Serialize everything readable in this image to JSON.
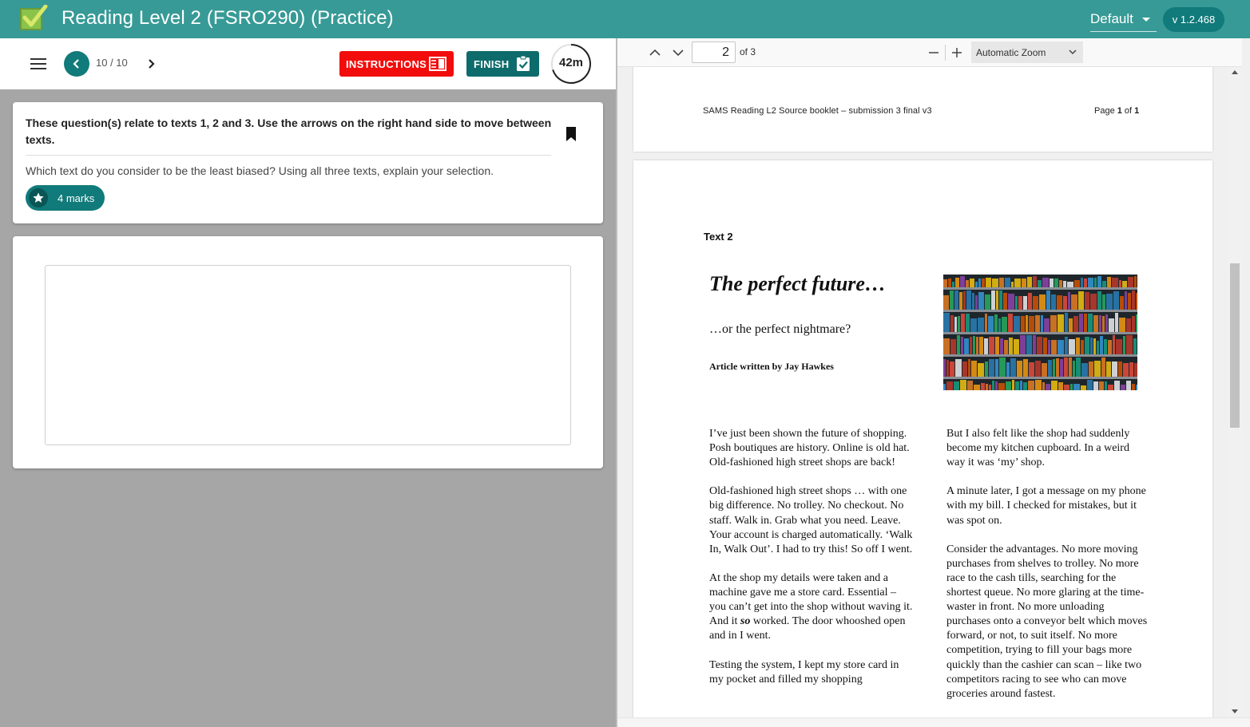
{
  "app": {
    "title": "Reading Level 2 (FSRO290) (Practice)",
    "theme": "Default",
    "version": "v 1.2.468",
    "accent_color": "#379a96",
    "icons": {
      "logo": "check-logo-icon",
      "theme_caret": "caret-down-icon"
    }
  },
  "toolbar": {
    "menu_icon": "hamburger-icon",
    "prev_icon": "chevron-left-icon",
    "next_icon": "chevron-right-icon",
    "counter": "10 / 10",
    "instructions_label": "INSTRUCTIONS",
    "instructions_icon": "book-icon",
    "instructions_color": "#f20c0c",
    "finish_label": "FINISH",
    "finish_icon": "clipboard-check-icon",
    "finish_color": "#0e6b6b",
    "timer": "42m",
    "timer_remaining_fraction": 0.7
  },
  "question": {
    "intro": "These question(s) relate to texts 1, 2 and 3. Use the arrows on the right hand side to move between texts.",
    "text": "Which text do you consider to be the least biased? Using all three texts, explain your selection.",
    "marks": "4 marks",
    "bookmark_icon": "bookmark-icon",
    "marks_icon": "star-icon"
  },
  "answer": {
    "value": "",
    "placeholder": ""
  },
  "pdf": {
    "toolbar": {
      "prev_page_icon": "chevron-up-icon",
      "next_page_icon": "chevron-down-icon",
      "page": "2",
      "of": "of 3",
      "zoom_out_icon": "minus-icon",
      "zoom_in_icon": "plus-icon",
      "zoom": "Automatic Zoom"
    },
    "page1_footer": {
      "left": "SAMS Reading L2 Source booklet – submission 3 final v3",
      "page_word": "Page ",
      "page_num": "1",
      "of_word": " of ",
      "page_total": "1"
    },
    "page2": {
      "text_label": "Text 2",
      "title": "The perfect future…",
      "subtitle": "…or the perfect nightmare?",
      "byline": "Article written by Jay Hawkes",
      "image_icon": "supermarket-shelves-photo",
      "col1": [
        "I’ve just been shown the future of shopping. Posh boutiques are history. Online is old hat. Old-fashioned high street shops are back!",
        "Old-fashioned high street shops … with one big difference. No trolley. No checkout. No staff. Walk in. Grab what you need. Leave. Your account is charged automatically. ‘Walk In, Walk Out’. I had to try this! So off I went.",
        "At the shop my details were taken and a machine gave me a store card. Essential – you can’t get into the shop without waving it. And it",
        "Testing the system, I kept my store card in my pocket and filled my shopping"
      ],
      "col1_p3_em": "so",
      "col1_p3_end": " worked. The door whooshed open and in I went.",
      "col2": [
        "But I also felt like the shop had suddenly become my kitchen cupboard. In a weird way it was ‘my’ shop.",
        "A minute later, I got a message on my phone with my bill. I checked for mistakes, but it was spot on.",
        "Consider the advantages. No more moving purchases from shelves to trolley. No more race to the cash tills, searching for the shortest queue. No more glaring at the time-waster in front. No more unloading purchases onto a conveyor belt which moves forward, or not, to suit itself. No more competition, trying to fill your bags more quickly than the cashier can scan – like two competitors racing to see who can move groceries around fastest."
      ]
    }
  }
}
